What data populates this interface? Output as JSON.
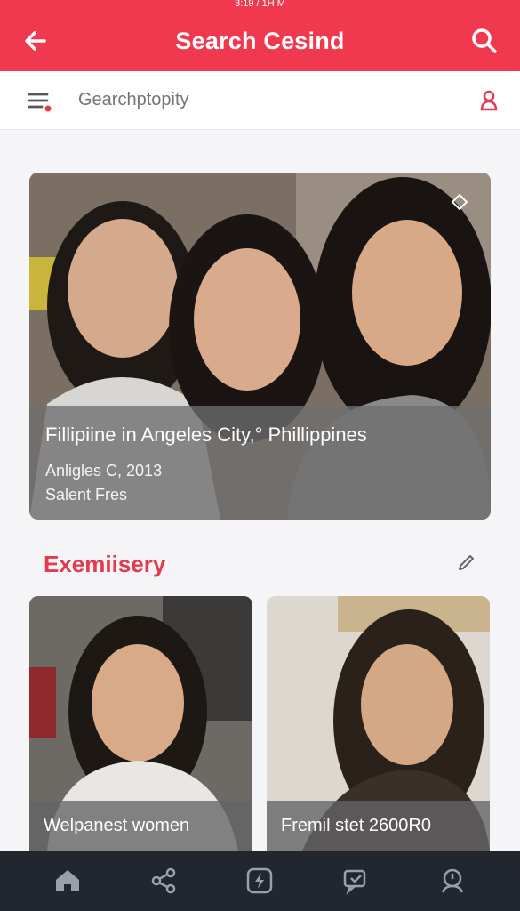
{
  "status_bar": {
    "text": "3:19 / 1H M"
  },
  "app_bar": {
    "title": "Search Cesind",
    "back_icon": "arrow-left-icon",
    "search_icon": "search-icon"
  },
  "search": {
    "placeholder": "Gearchptopity",
    "menu_icon": "filter-menu-icon",
    "profile_icon": "user-icon"
  },
  "hero": {
    "title": "Fillipiine in Angeles City,° Phillippines",
    "line2": "Anligles C, 2013",
    "line3": "Salent Fres",
    "badge_icon": "diamond-icon"
  },
  "section": {
    "label": "Exemiisery",
    "action_icon": "pencil-icon"
  },
  "cards": [
    {
      "caption": "Welpanest women"
    },
    {
      "caption": "Fremil stet 2600R0"
    }
  ],
  "nav": [
    {
      "icon": "home-icon"
    },
    {
      "icon": "share-icon"
    },
    {
      "icon": "bolt-icon"
    },
    {
      "icon": "chat-icon"
    },
    {
      "icon": "support-icon"
    }
  ],
  "colors": {
    "accent": "#f0384f",
    "section_label": "#e23a4e",
    "nav_bg": "#22262e"
  }
}
